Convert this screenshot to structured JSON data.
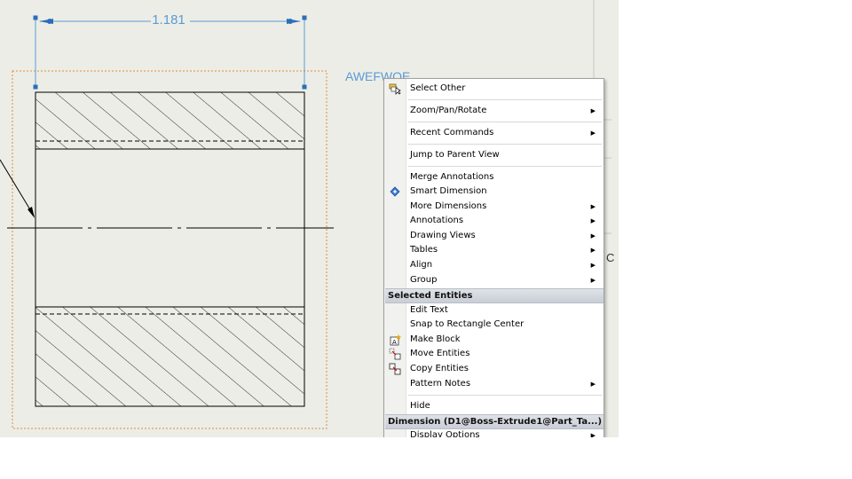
{
  "drawing": {
    "dimension_value": "1.181",
    "note_text": "AWEFWOE",
    "side_label": "C"
  },
  "menu": {
    "items": [
      {
        "label": "Select Other",
        "submenu": false,
        "icon": "select-other-icon"
      },
      {
        "label": "Zoom/Pan/Rotate",
        "submenu": true
      },
      {
        "label": "Recent Commands",
        "submenu": true
      },
      {
        "label": "Jump to Parent View",
        "submenu": false
      },
      {
        "label": "Merge Annotations",
        "submenu": false
      },
      {
        "label": "Smart Dimension",
        "submenu": false,
        "icon": "smart-dimension-icon"
      },
      {
        "label": "More Dimensions",
        "submenu": true
      },
      {
        "label": "Annotations",
        "submenu": true
      },
      {
        "label": "Drawing Views",
        "submenu": true
      },
      {
        "label": "Tables",
        "submenu": true
      },
      {
        "label": "Align",
        "submenu": true
      },
      {
        "label": "Group",
        "submenu": true
      },
      {
        "label": "Edit Text",
        "submenu": false
      },
      {
        "label": "Snap to Rectangle Center",
        "submenu": false
      },
      {
        "label": "Make Block",
        "submenu": false,
        "icon": "make-block-icon"
      },
      {
        "label": "Move Entities",
        "submenu": false,
        "icon": "move-entities-icon"
      },
      {
        "label": "Copy Entities",
        "submenu": false,
        "icon": "copy-entities-icon"
      },
      {
        "label": "Pattern Notes",
        "submenu": true
      },
      {
        "label": "Hide",
        "submenu": false
      },
      {
        "label": "Display Options",
        "submenu": true
      }
    ],
    "section_selected": "Selected Entities",
    "section_dimension": "Dimension (D1@Boss-Extrude1@Part_Ta...)"
  },
  "colors": {
    "canvas_bg": "#ecede6",
    "dimension_blue": "#5b9bd5",
    "handle_blue": "#2a6ebb",
    "bounding_orange": "#e08a3c"
  }
}
